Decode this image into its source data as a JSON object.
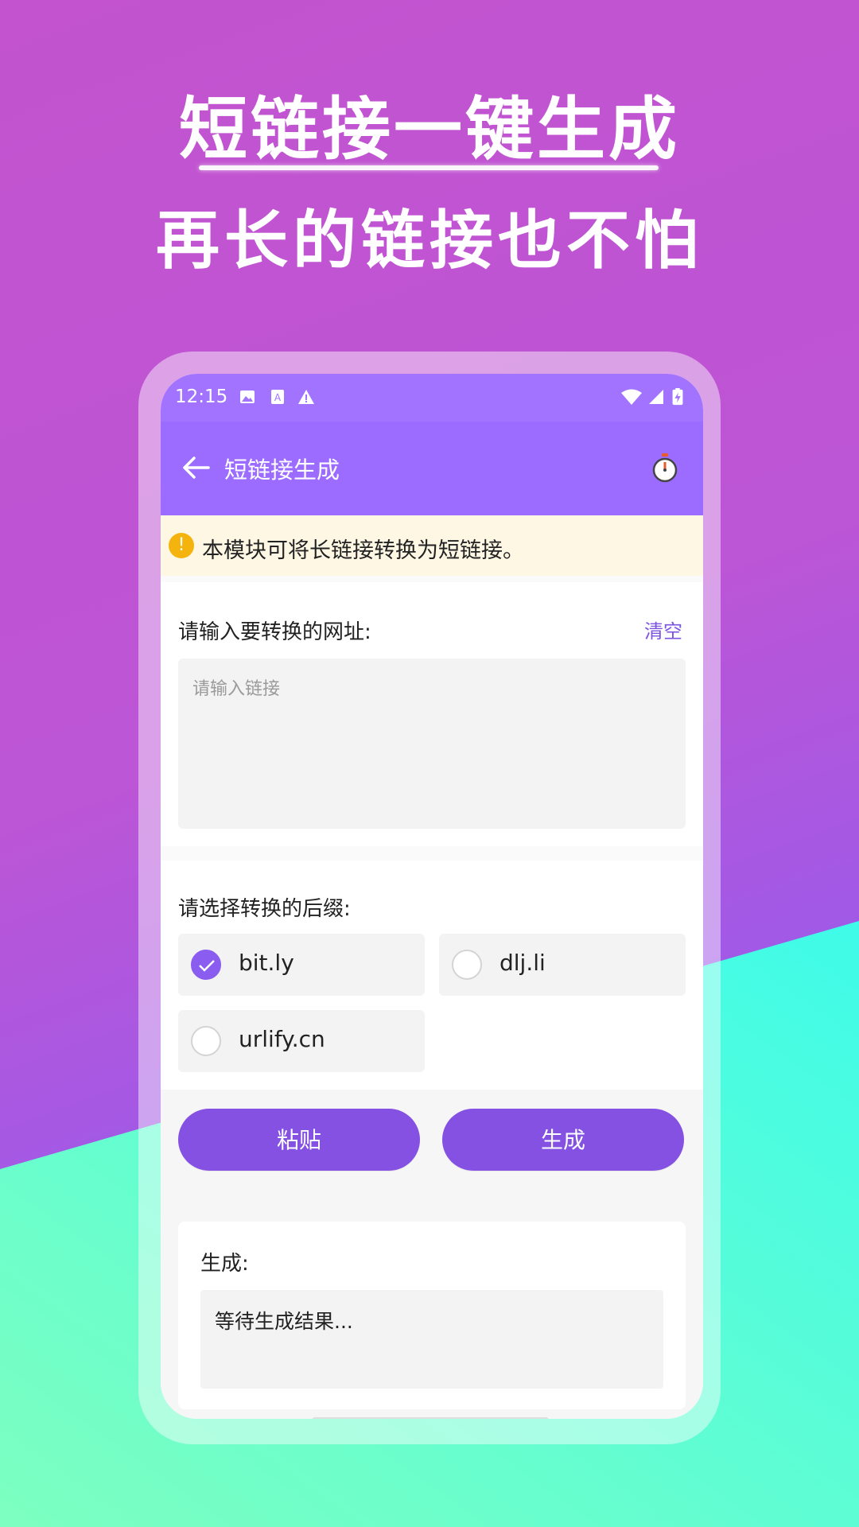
{
  "promo": {
    "headline": "短链接一键生成",
    "subheadline": "再长的链接也不怕"
  },
  "status_bar": {
    "time": "12:15"
  },
  "app_bar": {
    "title": "短链接生成"
  },
  "notice": {
    "text": "本模块可将长链接转换为短链接。"
  },
  "url_section": {
    "label": "请输入要转换的网址:",
    "clear_label": "清空",
    "input_value": "",
    "input_placeholder": "请输入链接"
  },
  "suffix_section": {
    "label": "请选择转换的后缀:",
    "options": [
      {
        "label": "bit.ly",
        "selected": true
      },
      {
        "label": "dlj.li",
        "selected": false
      },
      {
        "label": "urlify.cn",
        "selected": false
      }
    ]
  },
  "actions": {
    "paste_label": "粘贴",
    "generate_label": "生成"
  },
  "result": {
    "label": "生成:",
    "value": "等待生成结果..."
  },
  "colors": {
    "accent": "#8451e3",
    "app_bar": "#9b6cff",
    "notice_bg": "#fdf7e4",
    "warning": "#f5b40d"
  }
}
